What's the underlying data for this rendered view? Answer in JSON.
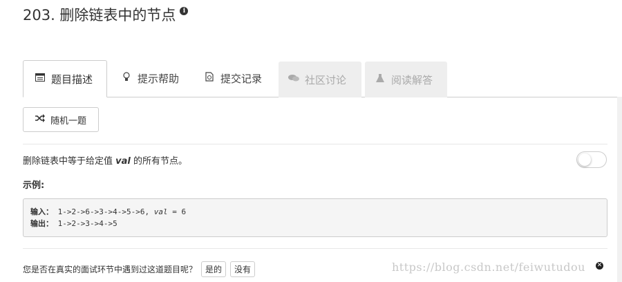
{
  "problem": {
    "title": "203. 删除链表中的节点"
  },
  "tabs": [
    {
      "label": "题目描述",
      "icon": "list-icon",
      "state": "active"
    },
    {
      "label": "提示帮助",
      "icon": "lightbulb-icon",
      "state": "normal"
    },
    {
      "label": "提交记录",
      "icon": "history-icon",
      "state": "normal"
    },
    {
      "label": "社区讨论",
      "icon": "comments-icon",
      "state": "disabled"
    },
    {
      "label": "阅读解答",
      "icon": "flask-icon",
      "state": "disabled"
    }
  ],
  "random_button": {
    "label": "随机一题",
    "icon": "shuffle-icon"
  },
  "description": {
    "before": "删除链表中等于给定值 ",
    "var": "val",
    "after": " 的所有节点。"
  },
  "example": {
    "label": "示例:",
    "input_label": "输入",
    "input_value": "1->2->6->3->4->5->6, ",
    "input_var": "val",
    "input_tail": " = 6",
    "output_label": "输出",
    "output_value": "1->2->3->4->5"
  },
  "interview_question": {
    "text": "您是否在真实的面试环节中遇到过这道题目呢？",
    "yes_label": "是的",
    "no_label": "没有"
  },
  "watermark": "https://blog.csdn.net/feiwutudou",
  "colors": {
    "active_tab_bg": "#ffffff",
    "disabled_tab_bg": "#eeeeee",
    "code_bg": "#f5f5f5",
    "border": "#cccccc"
  }
}
